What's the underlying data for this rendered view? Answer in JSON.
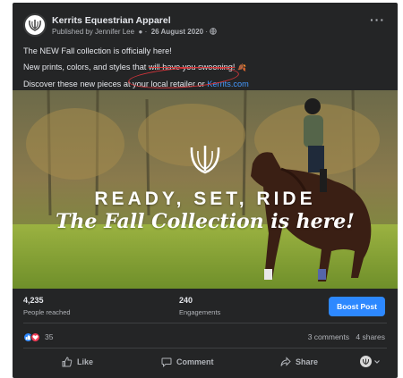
{
  "post": {
    "page_name": "Kerrits Equestrian Apparel",
    "published_by": "Published by Jennifer Lee",
    "date": "26 August 2020",
    "line1": "The NEW Fall collection is officially here!",
    "line2_before": "New prints, colors, and styles that ",
    "line2_strike": "will have you swooning!",
    "line2_emoji": "🍂",
    "line3_before": "Discover these new pieces at your local retailer or ",
    "line3_link": "Kerrits.com"
  },
  "image": {
    "headline": "READY, SET, RIDE",
    "subhead": "The Fall Collection is here!"
  },
  "stats": {
    "reached_value": "4,235",
    "reached_label": "People reached",
    "engagements_value": "240",
    "engagements_label": "Engagements",
    "boost_label": "Boost Post"
  },
  "engagement": {
    "reaction_count": "35",
    "comments": "3 comments",
    "shares": "4 shares"
  },
  "actions": {
    "like": "Like",
    "comment": "Comment",
    "share": "Share"
  },
  "icons": [
    "globe-icon",
    "more-icon",
    "like-reaction-icon",
    "love-reaction-icon",
    "thumbs-up-icon",
    "comment-icon",
    "share-icon",
    "chevron-down-icon",
    "kerrits-logo"
  ],
  "colors": {
    "background": "#242526",
    "accent": "#2d88ff",
    "text": "#e4e6eb",
    "muted": "#b0b3b8",
    "annotation": "#d0343a"
  }
}
